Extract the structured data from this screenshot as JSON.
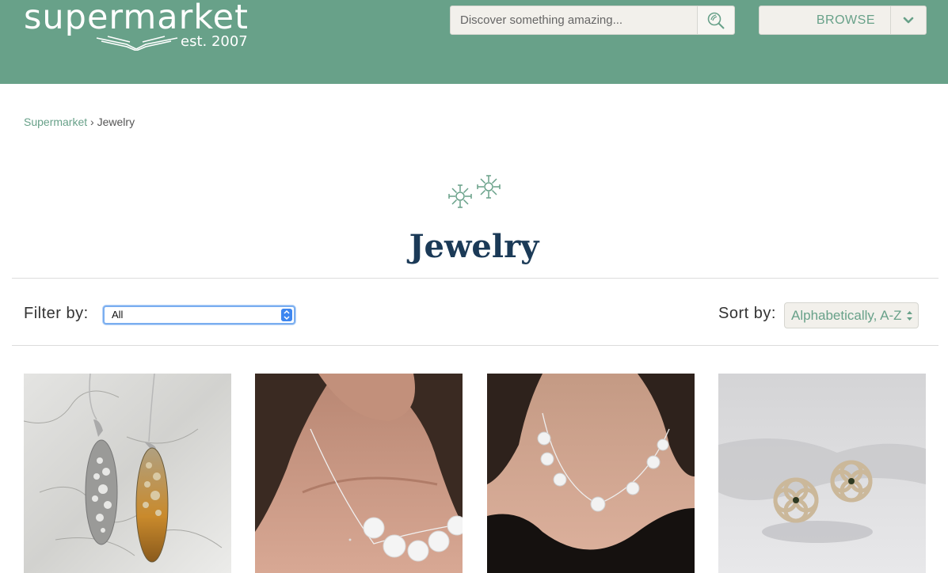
{
  "header": {
    "logo_word": "supermarket",
    "logo_est": "est. 2007",
    "search": {
      "placeholder": "Discover something amazing..."
    },
    "browse_label": "BROWSE"
  },
  "breadcrumb": {
    "home": "Supermarket",
    "separator": "›",
    "current": "Jewelry"
  },
  "page": {
    "title": "Jewelry"
  },
  "filter": {
    "label": "Filter by:",
    "selected": "All"
  },
  "sort": {
    "label": "Sort by:",
    "selected": "Alphabetically, A-Z"
  },
  "colors": {
    "brand_green": "#68a189",
    "title_navy": "#1b3a57",
    "focus_blue": "#3d86f0"
  },
  "products": [
    {
      "image": "earrings-oval-cutout-photo"
    },
    {
      "image": "necklace-flower-chain-photo"
    },
    {
      "image": "necklace-flower-links-photo"
    },
    {
      "image": "flower-stud-earrings-photo"
    }
  ]
}
